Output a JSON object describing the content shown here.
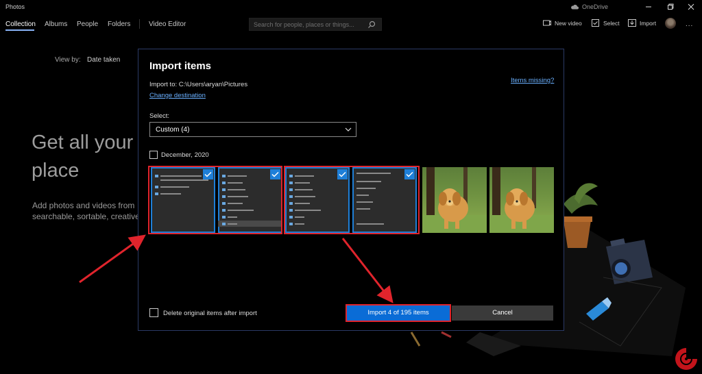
{
  "app": {
    "title": "Photos",
    "onedrive": "OneDrive"
  },
  "nav": {
    "tabs": [
      {
        "label": "Collection",
        "active": true
      },
      {
        "label": "Albums"
      },
      {
        "label": "People"
      },
      {
        "label": "Folders"
      },
      {
        "label": "Video Editor"
      }
    ],
    "search_placeholder": "Search for people, places or things...",
    "commands": {
      "new_video": "New video",
      "select": "Select",
      "import": "Import"
    },
    "more": "..."
  },
  "background": {
    "view_by_label": "View by:",
    "view_by_value": "Date taken",
    "hero_line1": "Get all your",
    "hero_line2": "place",
    "sub_line1": "Add photos and videos from",
    "sub_line2": "searchable, sortable, creative"
  },
  "dialog": {
    "title": "Import items",
    "import_to_label": "Import to:",
    "import_to_path": "C:\\Users\\aryan\\Pictures",
    "change_destination": "Change destination",
    "items_missing": "Items missing?",
    "select_label": "Select:",
    "select_value": "Custom (4)",
    "group_label": "December, 2020",
    "thumbnails": [
      {
        "kind": "screenshot",
        "selected": true
      },
      {
        "kind": "screenshot",
        "selected": true
      },
      {
        "kind": "screenshot",
        "selected": true
      },
      {
        "kind": "screenshot",
        "selected": true
      },
      {
        "kind": "dog-photo",
        "selected": false
      },
      {
        "kind": "dog-photo",
        "selected": false
      }
    ],
    "delete_after_import": "Delete original items after import",
    "import_button": "Import 4 of 195 items",
    "cancel_button": "Cancel"
  },
  "colors": {
    "accent": "#0a6cd6",
    "annotation": "#e0242c",
    "link": "#6ab0ff"
  }
}
